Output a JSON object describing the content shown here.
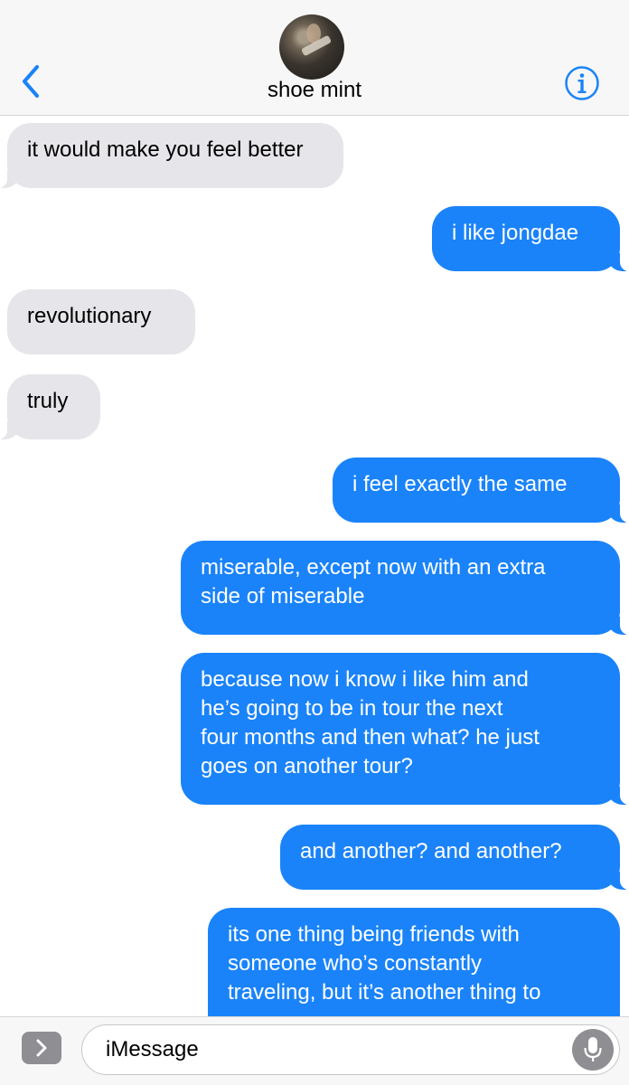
{
  "header": {
    "contact_name": "shoe mint",
    "icons": {
      "back": "chevron-left-icon",
      "info": "info-circle-icon",
      "avatar": "contact-avatar"
    },
    "accent_color": "#1a83f9"
  },
  "messages": [
    {
      "from": "received",
      "text": "it would make you feel better"
    },
    {
      "from": "sent",
      "text": "i like jongdae"
    },
    {
      "from": "received",
      "text": "revolutionary"
    },
    {
      "from": "received",
      "text": "truly"
    },
    {
      "from": "sent",
      "text": "i feel exactly the same"
    },
    {
      "from": "sent",
      "text": "miserable, except now with an extra\nside of miserable"
    },
    {
      "from": "sent",
      "text": "because now i know i like him and\nhe’s going to be in tour the next\nfour months and then what? he just\ngoes on another tour?"
    },
    {
      "from": "sent",
      "text": "and another? and another?"
    },
    {
      "from": "sent",
      "text": "its one thing being friends with\nsomeone who’s constantly\ntraveling, but it’s another thing to"
    }
  ],
  "composer": {
    "placeholder": "iMessage",
    "icons": {
      "apps": "chevron-right-icon",
      "mic": "microphone-icon"
    }
  },
  "colors": {
    "sent_bubble": "#1a83f9",
    "received_bubble": "#e5e5ea"
  }
}
